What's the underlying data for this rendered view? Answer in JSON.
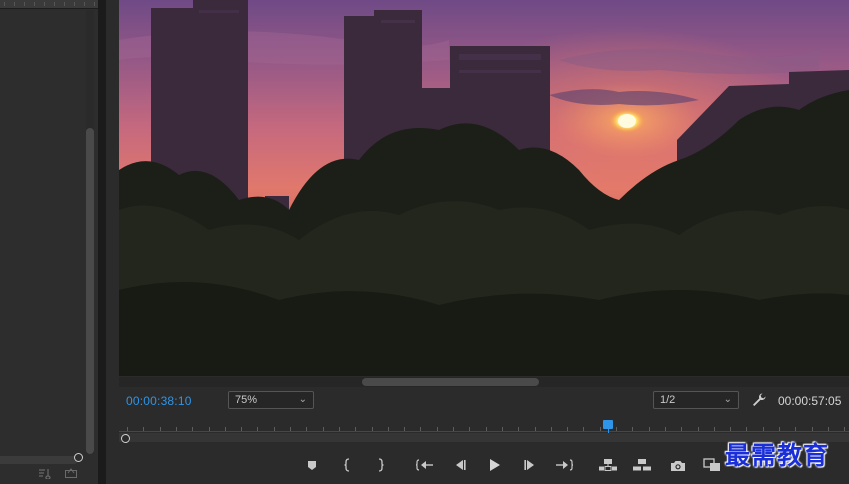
{
  "monitor": {
    "current_timecode": "00:00:38:10",
    "duration_timecode": "00:00:57:05",
    "zoom": {
      "selected": "75%"
    },
    "resolution": {
      "selected": "1/2"
    },
    "playhead_position": 0.67,
    "scroll_position": 0.44
  },
  "icons": {
    "wrench": "wrench-icon",
    "transport": [
      "marker-icon",
      "mark-in-icon",
      "mark-out-icon",
      "go-to-in-icon",
      "step-back-icon",
      "play-icon",
      "step-forward-icon",
      "go-to-out-icon",
      "lift-icon",
      "extract-icon",
      "camera-icon",
      "compare-icon"
    ]
  },
  "watermark": {
    "text": "最需教育"
  },
  "colors": {
    "accent": "#2e95e8",
    "panel": "#2b2b2b",
    "background": "#232323",
    "watermark": "#1b2fd8"
  }
}
